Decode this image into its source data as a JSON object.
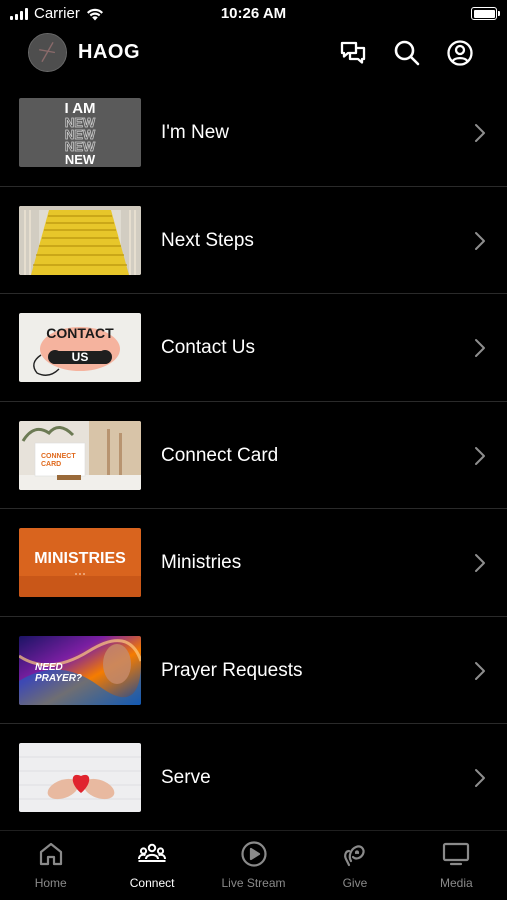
{
  "status_bar": {
    "carrier": "Carrier",
    "time": "10:26 AM"
  },
  "header": {
    "title": "HAOG",
    "icons": [
      "chat-icon",
      "search-icon",
      "account-icon"
    ]
  },
  "menu": {
    "items": [
      {
        "label": "I'm New",
        "thumb_text": [
          "I AM",
          "NEW",
          "NEW",
          "NEW",
          "NEW"
        ],
        "icon": "chevron-right-icon"
      },
      {
        "label": "Next Steps",
        "icon": "chevron-right-icon"
      },
      {
        "label": "Contact Us",
        "thumb_text": [
          "CONTACT",
          "US"
        ],
        "icon": "chevron-right-icon"
      },
      {
        "label": "Connect Card",
        "thumb_text": [
          "CONNECT",
          "CARD"
        ],
        "icon": "chevron-right-icon"
      },
      {
        "label": "Ministries",
        "thumb_text": [
          "MINISTRIES"
        ],
        "icon": "chevron-right-icon"
      },
      {
        "label": "Prayer Requests",
        "thumb_text": [
          "NEED",
          "PRAYER?"
        ],
        "icon": "chevron-right-icon"
      },
      {
        "label": "Serve",
        "icon": "chevron-right-icon"
      }
    ]
  },
  "tab_bar": {
    "active": "Connect",
    "tabs": [
      {
        "label": "Home",
        "icon": "home-icon"
      },
      {
        "label": "Connect",
        "icon": "people-icon"
      },
      {
        "label": "Live Stream",
        "icon": "play-circle-icon"
      },
      {
        "label": "Give",
        "icon": "give-icon"
      },
      {
        "label": "Media",
        "icon": "tv-icon"
      }
    ]
  },
  "colors": {
    "background": "#000000",
    "text": "#ffffff",
    "tab_inactive": "#8a8a8a",
    "separator": "#2a2a2a",
    "ministries_orange": "#d9641e"
  }
}
